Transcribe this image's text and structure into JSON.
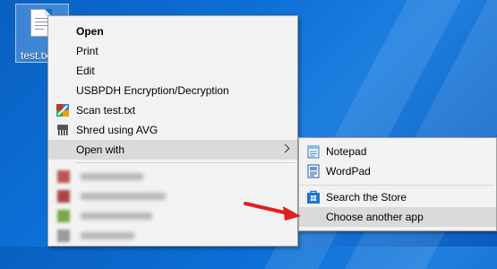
{
  "desktop": {
    "file_label": "test.txt"
  },
  "context_menu": {
    "items": [
      {
        "label": "Open",
        "bold": true
      },
      {
        "label": "Print"
      },
      {
        "label": "Edit"
      },
      {
        "label": "USBPDH Encryption/Decryption"
      },
      {
        "label": "Scan test.txt",
        "icon": "avg-scan-icon"
      },
      {
        "label": "Shred using AVG",
        "icon": "avg-shredder-icon"
      },
      {
        "label": "Open with",
        "submenu": true,
        "highlighted": true
      }
    ]
  },
  "open_with_submenu": {
    "items": [
      {
        "label": "Notepad",
        "icon": "notepad-icon"
      },
      {
        "label": "WordPad",
        "icon": "wordpad-icon"
      },
      {
        "label": "Search the Store",
        "icon": "store-icon"
      },
      {
        "label": "Choose another app",
        "highlighted": true
      }
    ]
  },
  "colors": {
    "wallpaper": "#0c6fd6",
    "menu_bg": "#f2f2f2",
    "highlight": "#dadada",
    "annotation_arrow": "#e02020"
  }
}
